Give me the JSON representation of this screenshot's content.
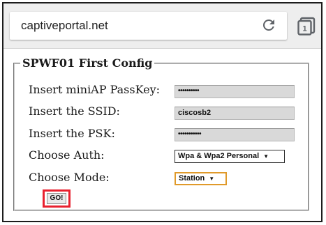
{
  "browser": {
    "url": "captiveportal.net",
    "tab_count": "1",
    "icons": {
      "reload": "reload-icon",
      "tabs": "tabs-icon"
    }
  },
  "form": {
    "legend": "SPWF01 First Config",
    "passkey": {
      "label": "Insert miniAP PassKey:",
      "value": "••••••••••"
    },
    "ssid": {
      "label": "Insert the SSID:",
      "value": "ciscosb2"
    },
    "psk": {
      "label": "Insert the PSK:",
      "value": "•••••••••••"
    },
    "auth": {
      "label": "Choose Auth:",
      "selected": "Wpa & Wpa2 Personal",
      "arrow": "▼"
    },
    "mode": {
      "label": "Choose Mode:",
      "selected": "Station",
      "arrow": "▼"
    },
    "submit_label": "GO!"
  },
  "colors": {
    "browser_bar": "#eeeeee",
    "field_bg": "#d9d9d9",
    "mode_focus_border": "#e09a2a",
    "go_highlight": "#e8202e"
  }
}
